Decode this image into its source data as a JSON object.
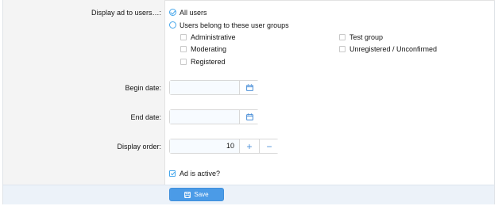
{
  "form": {
    "display_to": {
      "label": "Display ad to users…:",
      "options": [
        {
          "label": "All users",
          "checked": true
        },
        {
          "label": "Users belong to these user groups",
          "checked": false
        }
      ],
      "groups": [
        {
          "label": "Administrative",
          "checked": false
        },
        {
          "label": "Moderating",
          "checked": false
        },
        {
          "label": "Registered",
          "checked": false
        },
        {
          "label": "Test group",
          "checked": false
        },
        {
          "label": "Unregistered / Unconfirmed",
          "checked": false
        }
      ]
    },
    "begin_date": {
      "label": "Begin date:",
      "value": ""
    },
    "end_date": {
      "label": "End date:",
      "value": ""
    },
    "display_order": {
      "label": "Display order:",
      "value": "10",
      "plus": "+",
      "minus": "−"
    },
    "active": {
      "label": "Ad is active?",
      "checked": true
    },
    "save_label": "Save"
  },
  "icons": {
    "calendar": "calendar-icon",
    "save": "save-icon",
    "check": "check-icon"
  },
  "colors": {
    "accent": "#47a7eb",
    "button": "#4b9be7",
    "label_bg": "#f4f4f4",
    "footer_bg": "#ecf2f9"
  }
}
